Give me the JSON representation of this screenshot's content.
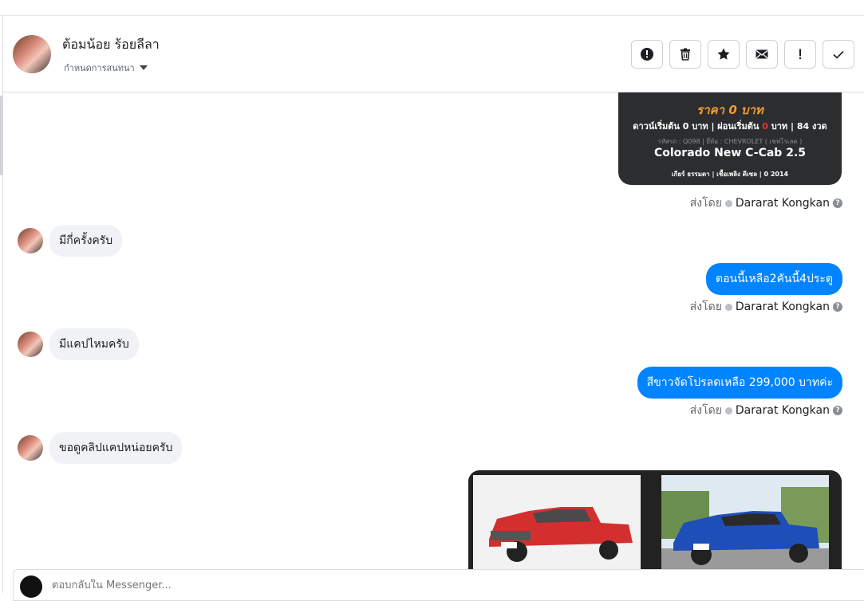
{
  "header": {
    "contact_name": "ต้อมน้อย ร้อยลีลา",
    "assign_label": "กำหนดการสนทนา"
  },
  "card": {
    "price": "ราคา 0 บาท",
    "dl_a": "ดาวน์เริ่มต้น 0 บาท | ผ่อนเริ่มต้น ",
    "dl_red": "0",
    "dl_b": " บาท | 84 งวด",
    "meta": "รหัสรถ : Q098 | ยี่ห้อ : CHEVROLET ( เชฟโรเลต )",
    "model": "Colorado New C-Cab 2.5",
    "specs": "เกียร์ ธรรมดา  |  เชื้อเพลิง ดีเซล  |  0 2014"
  },
  "sent_by_label": "ส่งโดย",
  "agent_name": "Dararat Kongkan",
  "messages": [
    {
      "text": "มีกี่ครั้งครับ"
    },
    {
      "text": "ตอนนี้เหลือ2คันนี้4ประตู"
    },
    {
      "text": "มีแคปไหมครับ"
    },
    {
      "text": "สีขาวจัดโปรลดเหลือ 299,000 บาทค่ะ"
    },
    {
      "text": "ขอดูคลิปแคปหน่อยครับ"
    }
  ],
  "composer": {
    "placeholder": "ตอบกลับใน Messenger..."
  },
  "colors": {
    "outgoing_bubble": "#0084ff",
    "incoming_bubble": "#f0f2f5",
    "card_bg": "#2b2d2f",
    "price_orange": "#f39c34"
  }
}
